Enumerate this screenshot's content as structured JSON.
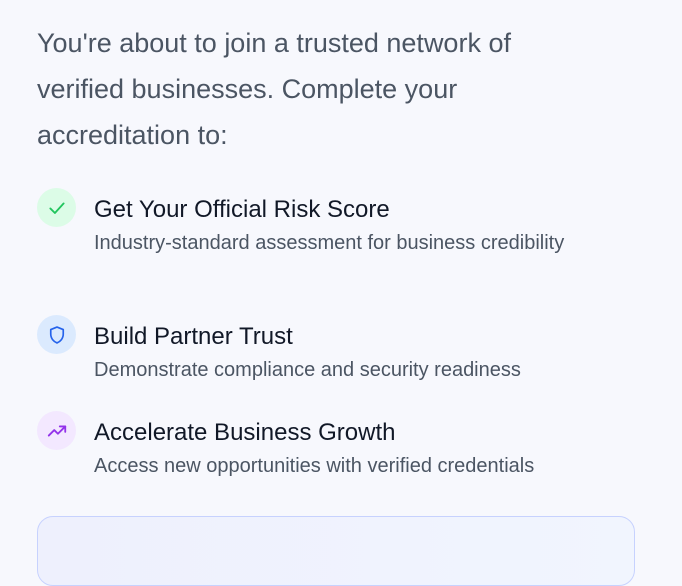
{
  "intro": {
    "text": "You're about to join a trusted network of verified businesses. Complete your accreditation to:"
  },
  "benefits": [
    {
      "icon": "check-icon",
      "icon_color": "#22c55e",
      "icon_bg": "#dcfce7",
      "title": "Get Your Official Risk Score",
      "description": "Industry-standard assessment for business credibility"
    },
    {
      "icon": "shield-icon",
      "icon_color": "#2563eb",
      "icon_bg": "#dbeafe",
      "title": "Build Partner Trust",
      "description": "Demonstrate compliance and security readiness"
    },
    {
      "icon": "trending-up-icon",
      "icon_color": "#9333ea",
      "icon_bg": "#f3e8ff",
      "title": "Accelerate Business Growth",
      "description": "Access new opportunities with verified credentials"
    }
  ]
}
